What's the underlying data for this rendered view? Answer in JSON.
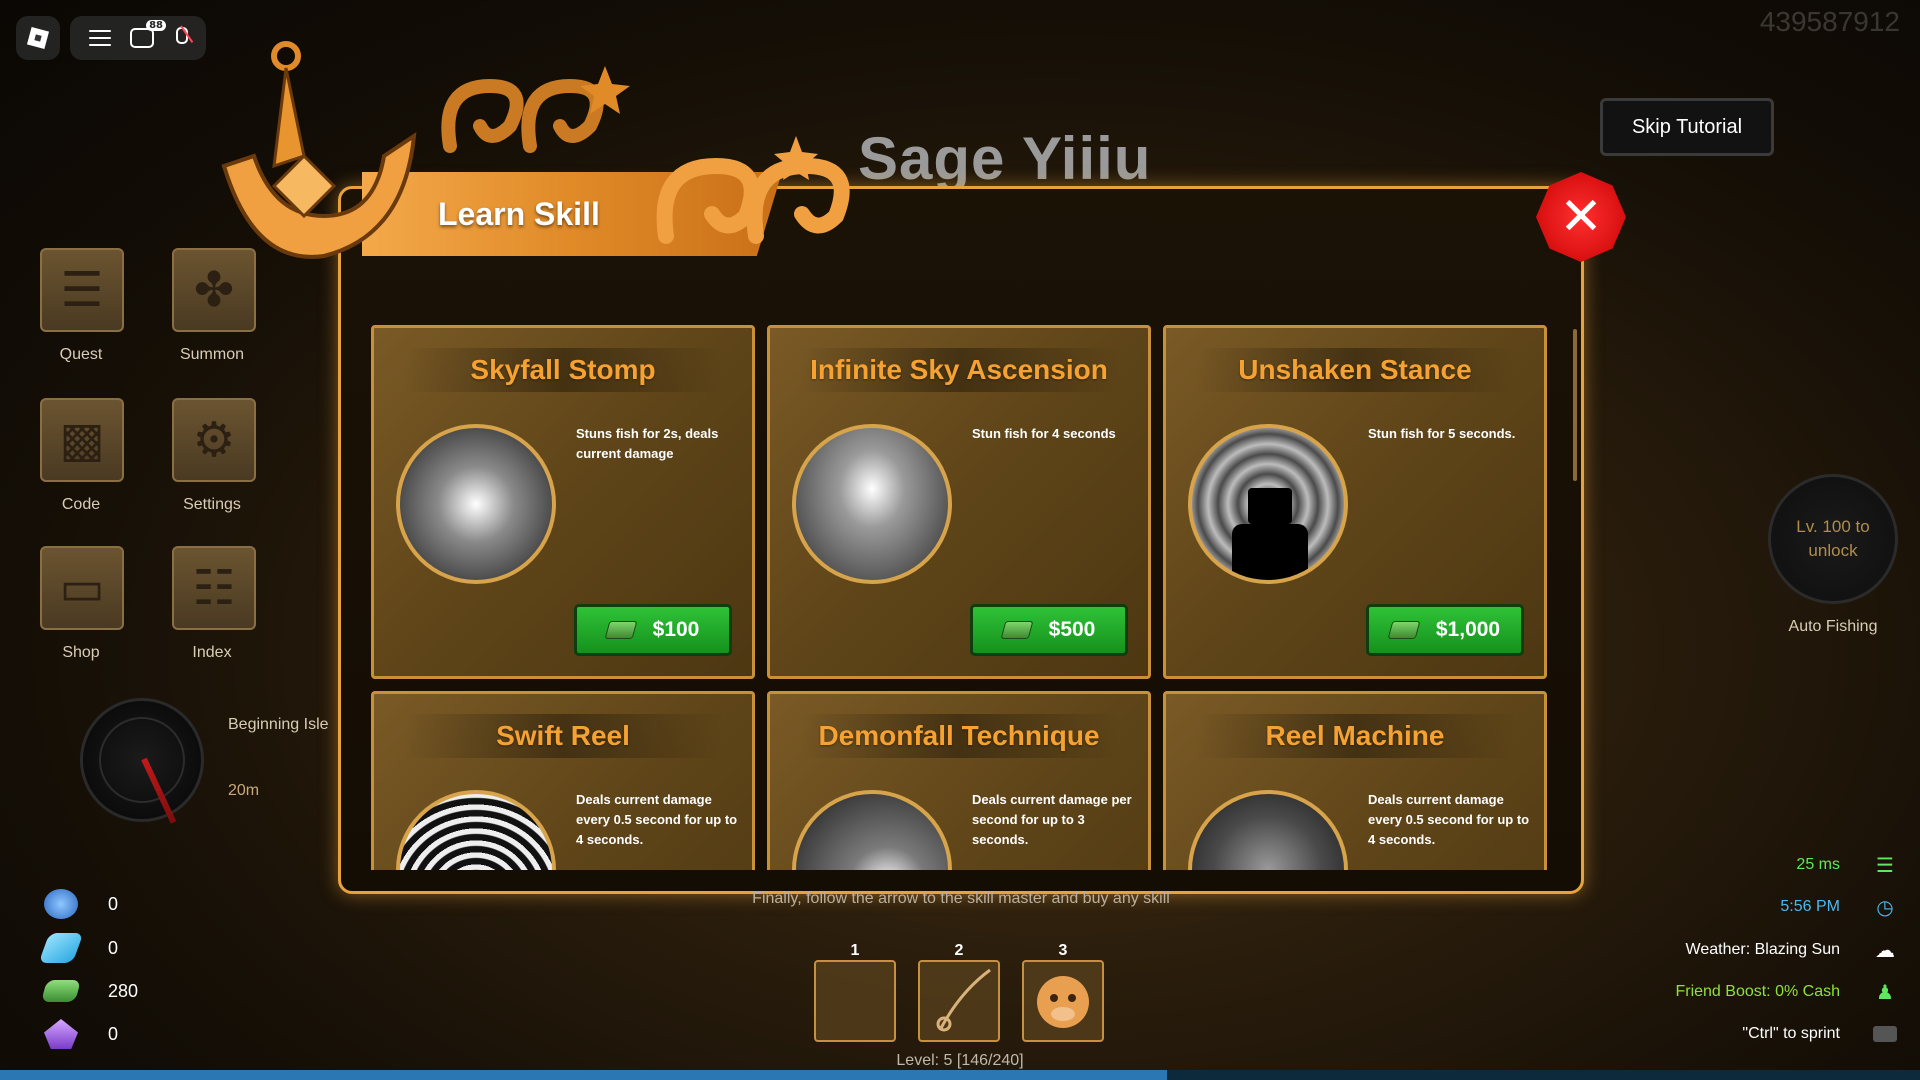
{
  "topbar": {
    "chat_badge": "88"
  },
  "user_id": "439587912",
  "left_menu": [
    {
      "label": "Quest",
      "icon": "quest-scroll-icon"
    },
    {
      "label": "Summon",
      "icon": "summon-icon"
    },
    {
      "label": "Code",
      "icon": "gift-icon"
    },
    {
      "label": "Settings",
      "icon": "gear-icon"
    },
    {
      "label": "Shop",
      "icon": "shop-bag-icon"
    },
    {
      "label": "Index",
      "icon": "book-icon"
    }
  ],
  "location": {
    "name": "Beginning Isle",
    "distance": "20m"
  },
  "currencies": [
    {
      "icon": "blue-orb-icon",
      "value": "0",
      "color": "#4a8fe0"
    },
    {
      "icon": "ticket-icon",
      "value": "0",
      "color": "#4ac3f0"
    },
    {
      "icon": "cash-icon",
      "value": "280",
      "color": "#5cc25a"
    },
    {
      "icon": "purple-crystal-icon",
      "value": "0",
      "color": "#a06ce0"
    }
  ],
  "skip_tutorial": "Skip Tutorial",
  "npc_name": "Sage Yiiiu",
  "panel": {
    "title": "Learn Skill",
    "skills": [
      {
        "name": "Skyfall Stomp",
        "description": "Stuns fish for 2s, deals current damage",
        "price": "$100"
      },
      {
        "name": "Infinite Sky Ascension",
        "description": "Stun fish for 4 seconds",
        "price": "$500"
      },
      {
        "name": "Unshaken Stance",
        "description": "Stun fish for 5 seconds.",
        "price": "$1,000"
      },
      {
        "name": "Swift Reel",
        "description": "Deals current damage every 0.5 second for up to 4 seconds.",
        "price": ""
      },
      {
        "name": "Demonfall Technique",
        "description": "Deals current damage per second for up to 3 seconds.",
        "price": ""
      },
      {
        "name": "Reel Machine",
        "description": "Deals current damage every 0.5 second for up to 4 seconds.",
        "price": ""
      }
    ]
  },
  "tutorial_text": "Finally, follow the arrow to the skill master and buy any skill",
  "hotbar": [
    {
      "num": "1"
    },
    {
      "num": "2"
    },
    {
      "num": "3"
    }
  ],
  "level_text": "Level: 5 [146/240]",
  "xp_progress": 0.608,
  "auto_fishing": {
    "lock_text": "Lv. 100 to unlock",
    "label": "Auto Fishing"
  },
  "stats": {
    "ping": "25 ms",
    "time": "5:56 PM",
    "weather": "Weather: Blazing Sun",
    "friend_boost": "Friend Boost: 0% Cash",
    "sprint": "\"Ctrl\" to sprint",
    "ping_color": "#5ee85e",
    "time_color": "#4ab8f0",
    "boost_color": "#8ee03a"
  }
}
